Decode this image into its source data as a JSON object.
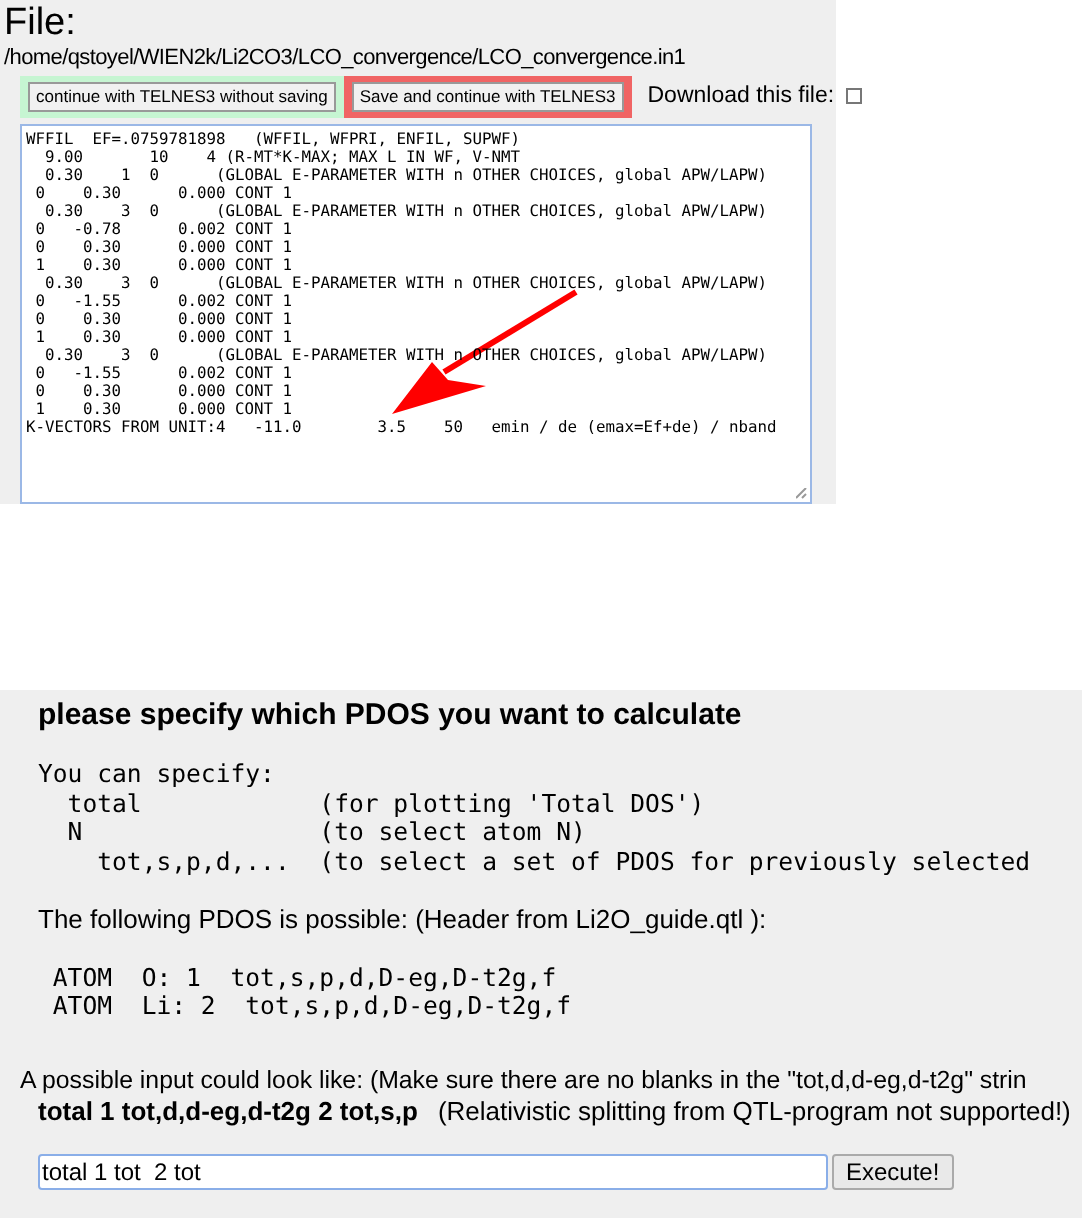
{
  "file_panel": {
    "title": "File:",
    "path": "/home/qstoyel/WIEN2k/Li2CO3/LCO_convergence/LCO_convergence.in1",
    "buttons": [
      {
        "label": "continue with TELNES3 without saving",
        "color": "#c6f5d2"
      },
      {
        "label": "Save and continue with TELNES3",
        "color": "#f06464"
      }
    ],
    "download": {
      "label": "Download this file:",
      "checked": false
    },
    "editor_lines": [
      "WFFIL  EF=.0759781898   (WFFIL, WFPRI, ENFIL, SUPWF)",
      "  9.00       10    4 (R-MT*K-MAX; MAX L IN WF, V-NMT",
      "  0.30    1  0      (GLOBAL E-PARAMETER WITH n OTHER CHOICES, global APW/LAPW)",
      " 0    0.30      0.000 CONT 1",
      "  0.30    3  0      (GLOBAL E-PARAMETER WITH n OTHER CHOICES, global APW/LAPW)",
      " 0   -0.78      0.002 CONT 1",
      " 0    0.30      0.000 CONT 1",
      " 1    0.30      0.000 CONT 1",
      "  0.30    3  0      (GLOBAL E-PARAMETER WITH n OTHER CHOICES, global APW/LAPW)",
      " 0   -1.55      0.002 CONT 1",
      " 0    0.30      0.000 CONT 1",
      " 1    0.30      0.000 CONT 1",
      "  0.30    3  0      (GLOBAL E-PARAMETER WITH n OTHER CHOICES, global APW/LAPW)",
      " 0   -1.55      0.002 CONT 1",
      " 0    0.30      0.000 CONT 1",
      " 1    0.30      0.000 CONT 1",
      "K-VECTORS FROM UNIT:4   -11.0        3.5    50   emin / de (emax=Ef+de) / nband"
    ]
  },
  "pdos_panel": {
    "heading": "please specify which PDOS you want to calculate",
    "usage_lines": [
      "You can specify:",
      "  total            (for plotting 'Total DOS')",
      "  N                (to select atom N)",
      "    tot,s,p,d,...  (to select a set of PDOS for previously selected"
    ],
    "possible_label": "The following PDOS is possible: (Header from Li2O_guide.qtl ):",
    "atom_lines": [
      " ATOM  O: 1  tot,s,p,d,D-eg,D-t2g,f",
      " ATOM  Li: 2  tot,s,p,d,D-eg,D-t2g,f"
    ],
    "example_intro": "A possible input could look like: (Make sure there are no blanks in the \"tot,d,d-eg,d-t2g\" strin",
    "example_input": "total 1 tot,d,d-eg,d-t2g 2 tot,s,p",
    "example_note": "(Relativistic splitting from QTL-program not supported!)",
    "input_value": "total 1 tot  2 tot",
    "execute_button": "Execute!"
  }
}
